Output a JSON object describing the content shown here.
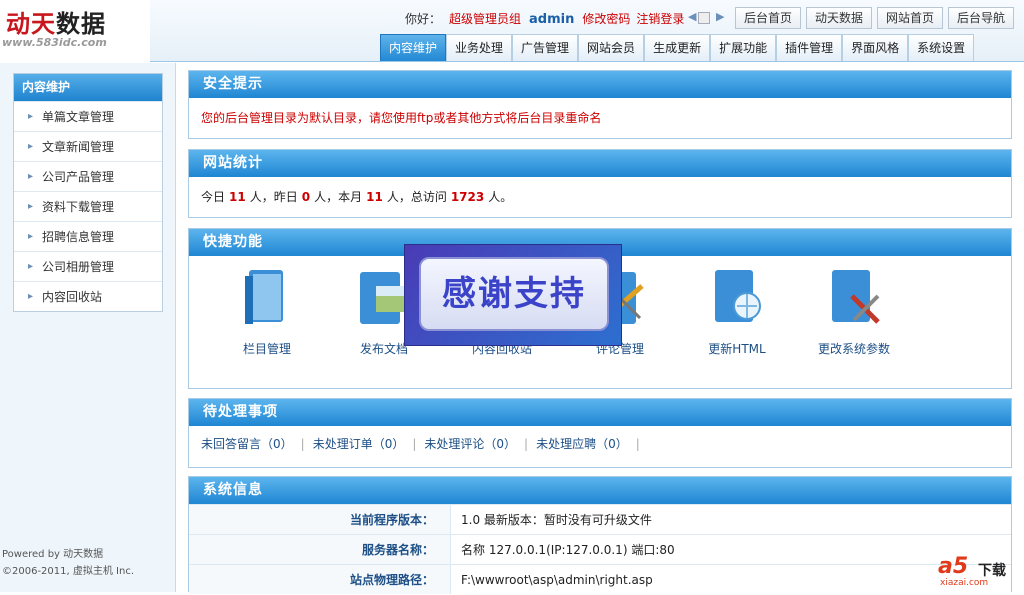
{
  "brand": {
    "name_red": "动天",
    "name_dark": "数据",
    "url": "www.583idc.com"
  },
  "header": {
    "greeting": "你好：",
    "group": "超级管理员组",
    "username": "admin",
    "change_password": "修改密码",
    "logout": "注销登录",
    "quick_buttons": [
      "后台首页",
      "动天数据",
      "网站首页",
      "后台导航"
    ]
  },
  "tabs": [
    "内容维护",
    "业务处理",
    "广告管理",
    "网站会员",
    "生成更新",
    "扩展功能",
    "插件管理",
    "界面风格",
    "系统设置"
  ],
  "sidebar": {
    "title": "内容维护",
    "items": [
      "单篇文章管理",
      "文章新闻管理",
      "公司产品管理",
      "资料下载管理",
      "招聘信息管理",
      "公司相册管理",
      "内容回收站"
    ],
    "footer_line1": "Powered by 动天数据",
    "footer_line2": "©2006-2011, 虚拟主机 Inc."
  },
  "security": {
    "title": "安全提示",
    "message": "您的后台管理目录为默认目录，请您使用ftp或者其他方式将后台目录重命名"
  },
  "stats": {
    "title": "网站统计",
    "t1": "今日",
    "today": "11",
    "u1": "人，昨日",
    "yesterday": "0",
    "u2": "人，本月",
    "month": "11",
    "u3": "人，总访问",
    "total": "1723",
    "u4": "人。"
  },
  "quick": {
    "title": "快捷功能",
    "items": [
      "栏目管理",
      "发布文档",
      "内容回收站",
      "评论管理",
      "更新HTML",
      "更改系统参数"
    ]
  },
  "todo": {
    "title": "待处理事项",
    "items": [
      "未回答留言（0）",
      "未处理订单（0）",
      "未处理评论（0）",
      "未处理应聘（0）"
    ]
  },
  "sysinfo": {
    "title": "系统信息",
    "rows": [
      {
        "k": "当前程序版本：",
        "v": "1.0 最新版本：暂时没有可升级文件"
      },
      {
        "k": "服务器名称：",
        "v": "名称 127.0.0.1(IP:127.0.0.1) 端口:80"
      },
      {
        "k": "站点物理路径：",
        "v": "F:\\wwwroot\\asp\\admin\\right.asp"
      }
    ]
  },
  "overlay": {
    "text": "感谢支持"
  },
  "watermark": {
    "a5": "a5",
    "dl": "下载",
    "sub": "xiazai.com"
  },
  "colors": {
    "accent": "#1f86d2",
    "alert": "#cc0000",
    "link": "#1d4f86"
  }
}
